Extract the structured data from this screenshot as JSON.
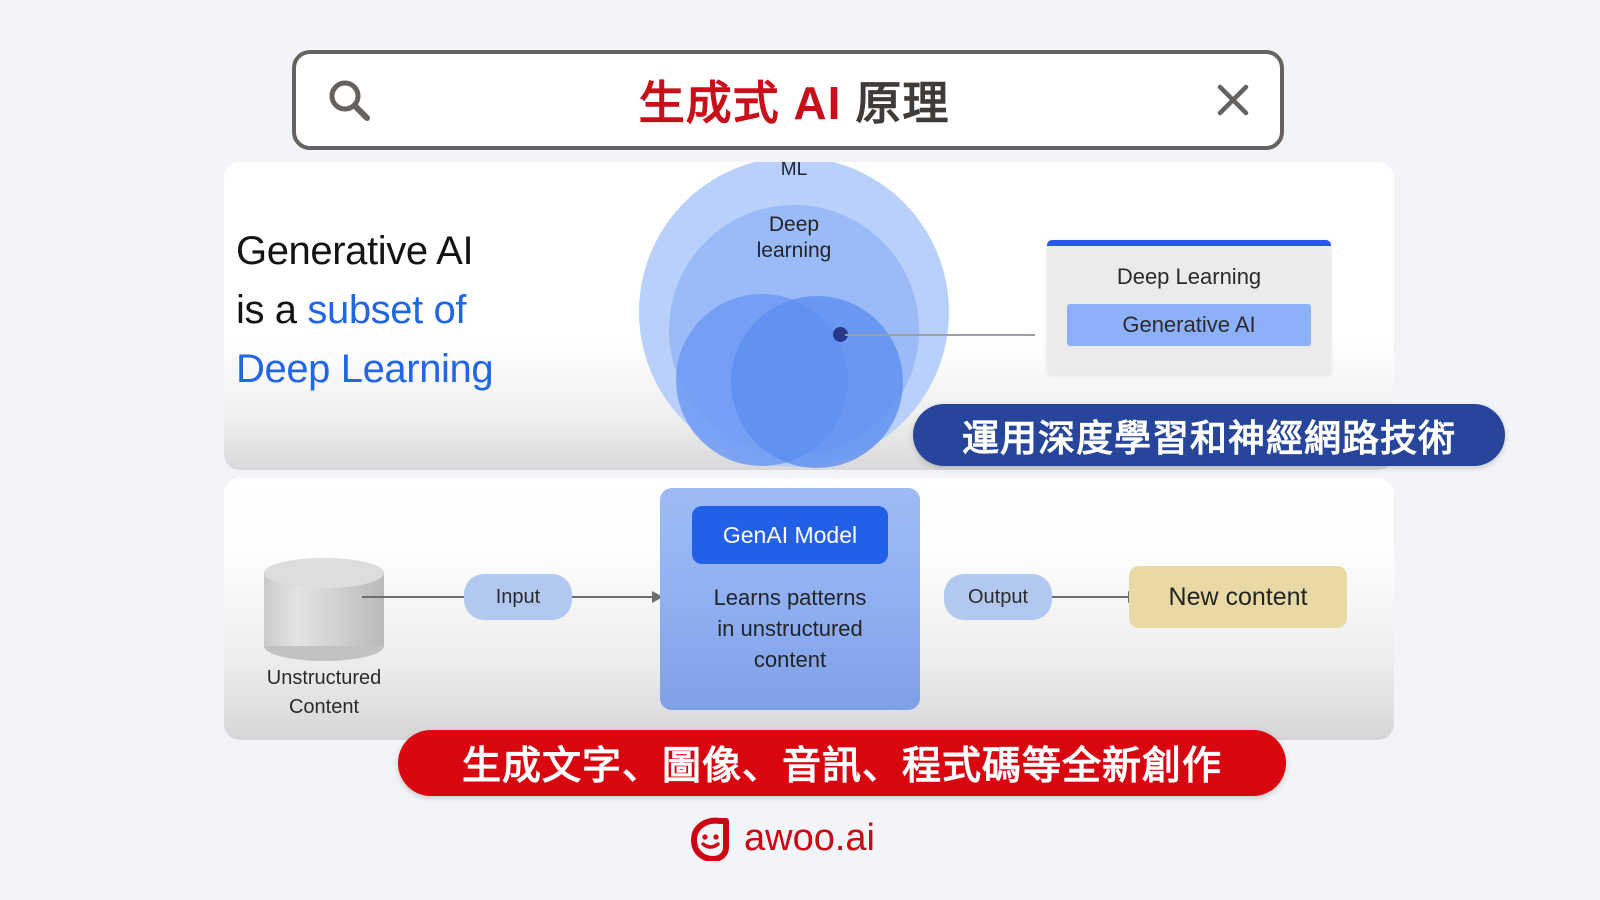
{
  "search": {
    "icon": "search-icon",
    "query_red": "生成式 AI",
    "query_dark": "原理",
    "close_icon": "close-icon",
    "placeholder": "",
    "colors": {
      "red": "#c8101a",
      "dark": "#3f3b39",
      "border": "#66625f"
    }
  },
  "top_card": {
    "headline": {
      "line1": "Generative AI",
      "line2_plain": "is a ",
      "line2_blue": "subset of",
      "line3_blue": "Deep Learning"
    },
    "venn": {
      "outer_label": "ML",
      "middle_label": "Deep\nlearning",
      "outer_color": "#b8d0fa",
      "middle_color": "#8fb4f7",
      "inner_a_color": "#6f9bf2",
      "inner_b_color": "#5b8df0",
      "connector_dot_color": "#27388a"
    },
    "legend": {
      "accent_bar_color": "#2a5ae0",
      "items": [
        {
          "label": "Deep Learning",
          "highlighted": false
        },
        {
          "label": "Generative AI",
          "highlighted": true
        }
      ],
      "highlight_color": "#8cb0fa"
    }
  },
  "banner_blue": {
    "text": "運用深度學習和神經網路技術",
    "background": "#27469b",
    "text_color": "#ffffff"
  },
  "bottom_card": {
    "source": {
      "icon": "database-cylinder-icon",
      "caption": "Unstructured\nContent"
    },
    "pill_input": "Input",
    "pill_output": "Output",
    "model": {
      "header": "GenAI Model",
      "body": "Learns patterns\nin unstructured\ncontent",
      "header_color": "#2360e8",
      "box_color": "#8fb0f2"
    },
    "result": {
      "label": "New content",
      "background": "#e9d9a4"
    },
    "arrow_color": "#6d6e70"
  },
  "banner_red": {
    "text": "生成文字、圖像、音訊、程式碼等全新創作",
    "background": "#d9060f",
    "text_color": "#ffffff"
  },
  "footer": {
    "logo_mark": "awoo-smiley-a-icon",
    "logo_text": "awoo.ai",
    "color": "#cc0713"
  },
  "page": {
    "background": "#f2f4f7"
  }
}
